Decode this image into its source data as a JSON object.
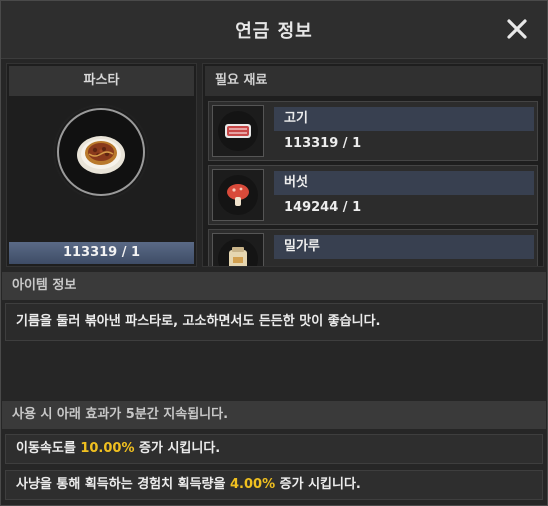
{
  "window": {
    "title": "연금 정보"
  },
  "item": {
    "name": "파스타",
    "count": "113319 / 1"
  },
  "materials": {
    "header": "필요 재료",
    "items": [
      {
        "name": "고기",
        "count": "113319 / 1",
        "icon": "meat-icon"
      },
      {
        "name": "버섯",
        "count": "149244 / 1",
        "icon": "mushroom-icon"
      },
      {
        "name": "밀가루",
        "count": "",
        "icon": "flour-icon"
      }
    ]
  },
  "info": {
    "header": "아이템 정보",
    "description": "기름을 둘러 볶아낸 파스타로, 고소하면서도 든든한 맛이 좋습니다."
  },
  "effects": {
    "header": "사용 시 아래 효과가 5분간 지속됩니다.",
    "items": [
      {
        "prefix": "이동속도를 ",
        "value": "10.00%",
        "suffix": " 증가 시킵니다."
      },
      {
        "prefix": "사냥을 통해 획득하는 경험치 획득량을 ",
        "value": "4.00%",
        "suffix": " 증가 시킵니다."
      }
    ]
  },
  "colors": {
    "highlight": "#f0c020",
    "count_bar": "#4a5874",
    "name_bar": "#384050"
  }
}
